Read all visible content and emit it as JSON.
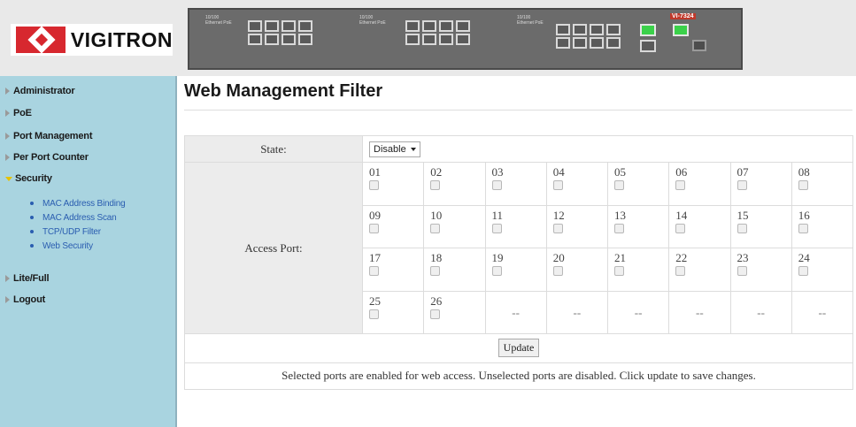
{
  "header": {
    "logo_text": "VIGITRON",
    "switch_groups": [
      {
        "label": "10/100 Ethernet PoE"
      },
      {
        "label": "10/100 Ethernet PoE"
      },
      {
        "label": "10/100 Ethernet PoE"
      }
    ],
    "brand_mini": "VI-7324"
  },
  "sidebar": {
    "items": [
      {
        "label": "Administrator",
        "icon": "arrow-right-icon"
      },
      {
        "label": "PoE",
        "icon": "arrow-right-icon"
      },
      {
        "label": "Port Management",
        "icon": "arrow-right-icon"
      },
      {
        "label": "Per Port Counter",
        "icon": "arrow-right-icon"
      },
      {
        "label": "Security",
        "icon": "arrow-down-icon",
        "expanded": true
      },
      {
        "label": "Lite/Full",
        "icon": "arrow-right-icon"
      },
      {
        "label": "Logout",
        "icon": "arrow-right-icon"
      }
    ],
    "security_subitems": [
      {
        "label": "MAC Address Binding"
      },
      {
        "label": "MAC Address Scan"
      },
      {
        "label": "TCP/UDP Filter"
      },
      {
        "label": "Web Security"
      }
    ]
  },
  "main": {
    "title": "Web Management Filter",
    "state_label": "State:",
    "state_value": "Disable",
    "access_port_label": "Access Port:",
    "ports": [
      "01",
      "02",
      "03",
      "04",
      "05",
      "06",
      "07",
      "08",
      "09",
      "10",
      "11",
      "12",
      "13",
      "14",
      "15",
      "16",
      "17",
      "18",
      "19",
      "20",
      "21",
      "22",
      "23",
      "24",
      "25",
      "26"
    ],
    "empty_cell": "--",
    "update_label": "Update",
    "note": "Selected ports are enabled for web access. Unselected ports are disabled. Click update to save changes."
  },
  "colors": {
    "sidebar_bg": "#a9d4e0",
    "header_bg": "#e9e9e9",
    "logo_red": "#d7282f",
    "link_blue": "#2a5db0",
    "port_led_green": "#3bd14a"
  }
}
